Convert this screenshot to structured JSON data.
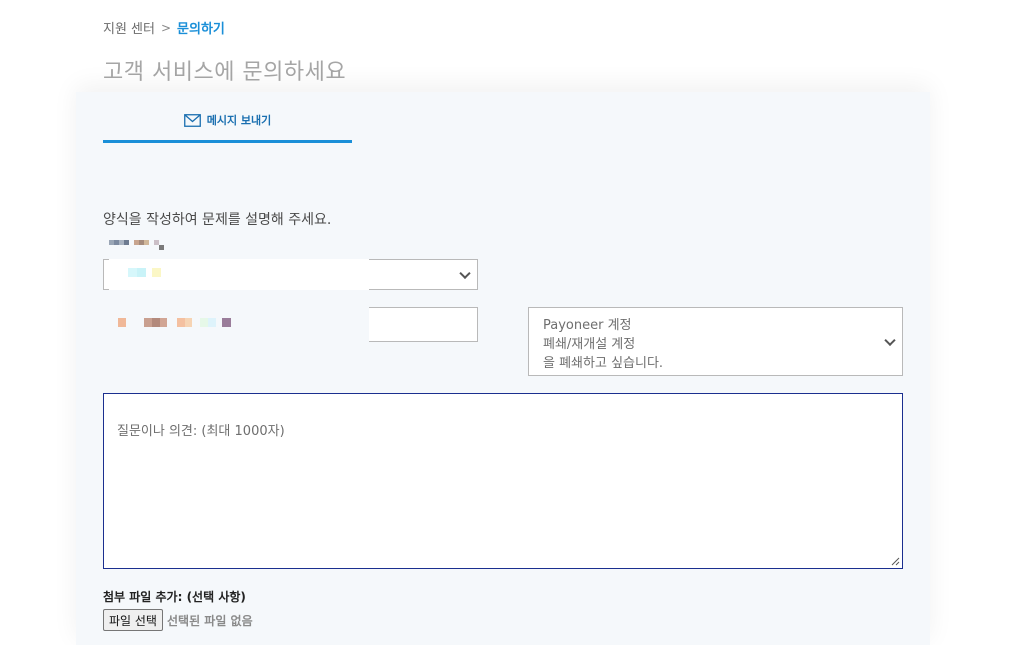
{
  "breadcrumb": {
    "parent": "지원 센터",
    "separator": ">",
    "current": "문의하기"
  },
  "page": {
    "title": "고객 서비스에 문의하세요"
  },
  "tabs": [
    {
      "label": "메시지 보내기",
      "icon": "envelope-icon",
      "active": true
    }
  ],
  "form": {
    "instructions": "양식을 작성하여 문제를 설명해 주세요.",
    "category_select": {
      "value": ""
    },
    "account_field": {
      "value": ""
    },
    "topic_select": {
      "line1": "Payoneer 계정",
      "line2": "폐쇄/재개설 계정",
      "line3": "을 폐쇄하고 싶습니다."
    },
    "message": {
      "placeholder": "질문이나 의견: (최대 1000자)"
    },
    "attachment": {
      "label": "첨부 파일 추가: (선택 사항)",
      "button_label": "파일 선택",
      "status": "선택된 파일 없음"
    }
  },
  "colors": {
    "accent": "#1a8fd8",
    "card_background": "#f5f8fb",
    "textarea_border": "#1b2f8f"
  }
}
